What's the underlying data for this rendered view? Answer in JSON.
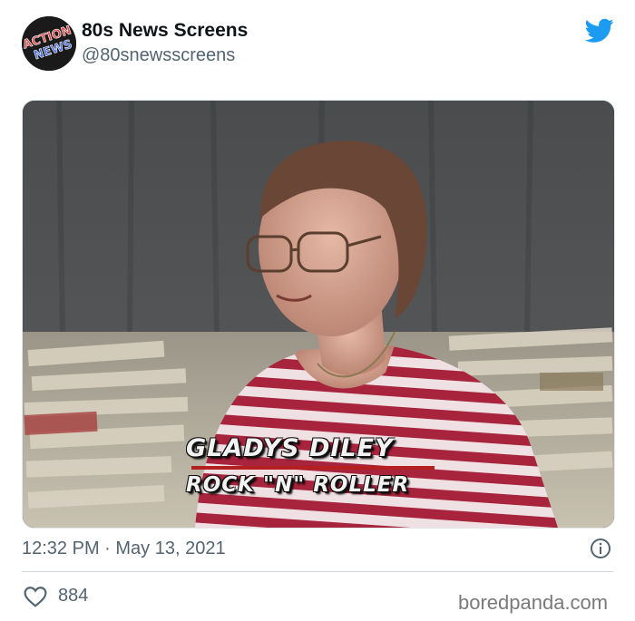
{
  "tweet": {
    "display_name": "80s News Screens",
    "handle": "@80snewsscreens",
    "avatar_text": [
      "ACTION",
      "NEWS"
    ],
    "timestamp": "12:32 PM · May 13, 2021",
    "like_count": "884"
  },
  "media": {
    "lower_third_name": "GLADYS DILEY",
    "lower_third_title": "ROCK \"N\" ROLLER"
  },
  "watermark": "boredpanda.com",
  "colors": {
    "twitter_blue": "#1d9bf0",
    "secondary_text": "#536471",
    "lower_third_bar": "#b42020"
  },
  "icons": [
    "twitter-bird-icon",
    "info-icon",
    "heart-icon"
  ]
}
